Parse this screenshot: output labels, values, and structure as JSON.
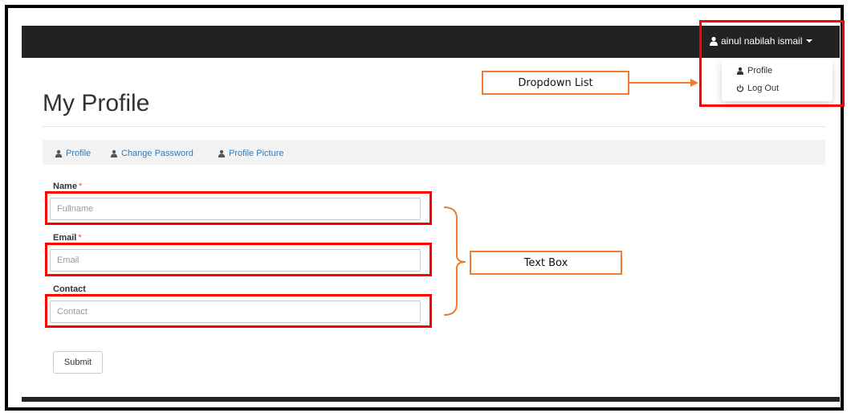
{
  "header": {
    "user_name": "ainul nabilah ismail",
    "user_icon": "user-icon",
    "caret_icon": "caret-down-icon"
  },
  "dropdown": {
    "items": [
      {
        "label": "Profile",
        "icon": "user-icon"
      },
      {
        "label": "Log Out",
        "icon": "power-icon"
      }
    ]
  },
  "page": {
    "title": "My Profile"
  },
  "subnav": {
    "items": [
      {
        "label": "Profile",
        "icon": "user-icon"
      },
      {
        "label": "Change Password",
        "icon": "user-icon"
      },
      {
        "label": "Profile Picture",
        "icon": "user-icon"
      }
    ]
  },
  "form": {
    "name": {
      "label": "Name",
      "required_mark": "*",
      "placeholder": "Fullname",
      "value": ""
    },
    "email": {
      "label": "Email",
      "required_mark": "*",
      "placeholder": "Email",
      "value": ""
    },
    "contact": {
      "label": "Contact",
      "placeholder": "Contact",
      "value": ""
    },
    "submit_label": "Submit"
  },
  "annotations": {
    "dropdown_label": "Dropdown List",
    "textbox_label": "Text Box",
    "highlight_color": "#ff0000",
    "callout_color": "#ed7d31"
  },
  "colors": {
    "navbar": "#222222",
    "link": "#337ab7"
  }
}
